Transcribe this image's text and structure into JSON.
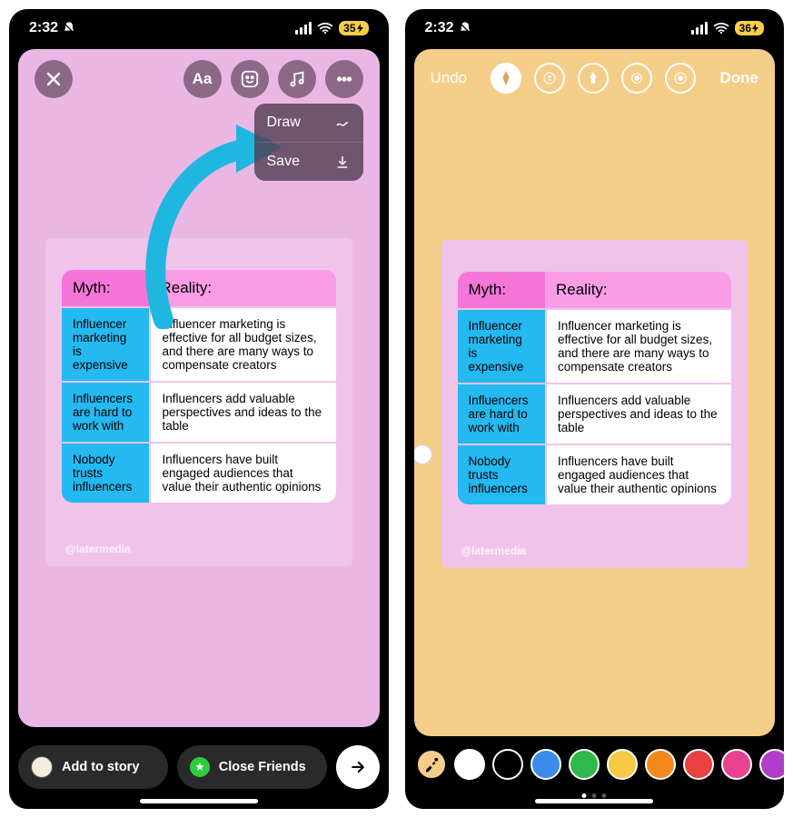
{
  "left": {
    "status": {
      "time": "2:32",
      "battery": "35"
    },
    "menu": {
      "draw": "Draw",
      "save": "Save"
    },
    "card": {
      "headers": {
        "myth": "Myth:",
        "reality": "Reality:"
      },
      "rows": [
        {
          "myth": "Influencer marketing is expensive",
          "reality": "Influencer marketing is effective for all budget sizes, and there are many ways to compensate creators"
        },
        {
          "myth": "Influencers are hard to work with",
          "reality": "Influencers add valuable perspectives and ideas to the table"
        },
        {
          "myth": "Nobody trusts influencers",
          "reality": "Influencers have built engaged audiences that value their authentic opinions"
        }
      ],
      "watermark": "@latermedia"
    },
    "bottom": {
      "add": "Add to story",
      "close": "Close Friends"
    }
  },
  "right": {
    "status": {
      "time": "2:32",
      "battery": "36"
    },
    "top": {
      "undo": "Undo",
      "done": "Done"
    },
    "card": {
      "headers": {
        "myth": "Myth:",
        "reality": "Reality:"
      },
      "rows": [
        {
          "myth": "Influencer marketing is expensive",
          "reality": "Influencer marketing is effective for all budget sizes, and there are many ways to compensate creators"
        },
        {
          "myth": "Influencers are hard to work with",
          "reality": "Influencers add valuable perspectives and ideas to the table"
        },
        {
          "myth": "Nobody trusts influencers",
          "reality": "Influencers have built engaged audiences that value their authentic opinions"
        }
      ],
      "watermark": "@latermedia"
    },
    "palette": [
      "#ffffff",
      "#000000",
      "#3a8bea",
      "#2fb84c",
      "#f7c944",
      "#f28a1e",
      "#e94040",
      "#e9408f",
      "#b03ec8"
    ]
  }
}
